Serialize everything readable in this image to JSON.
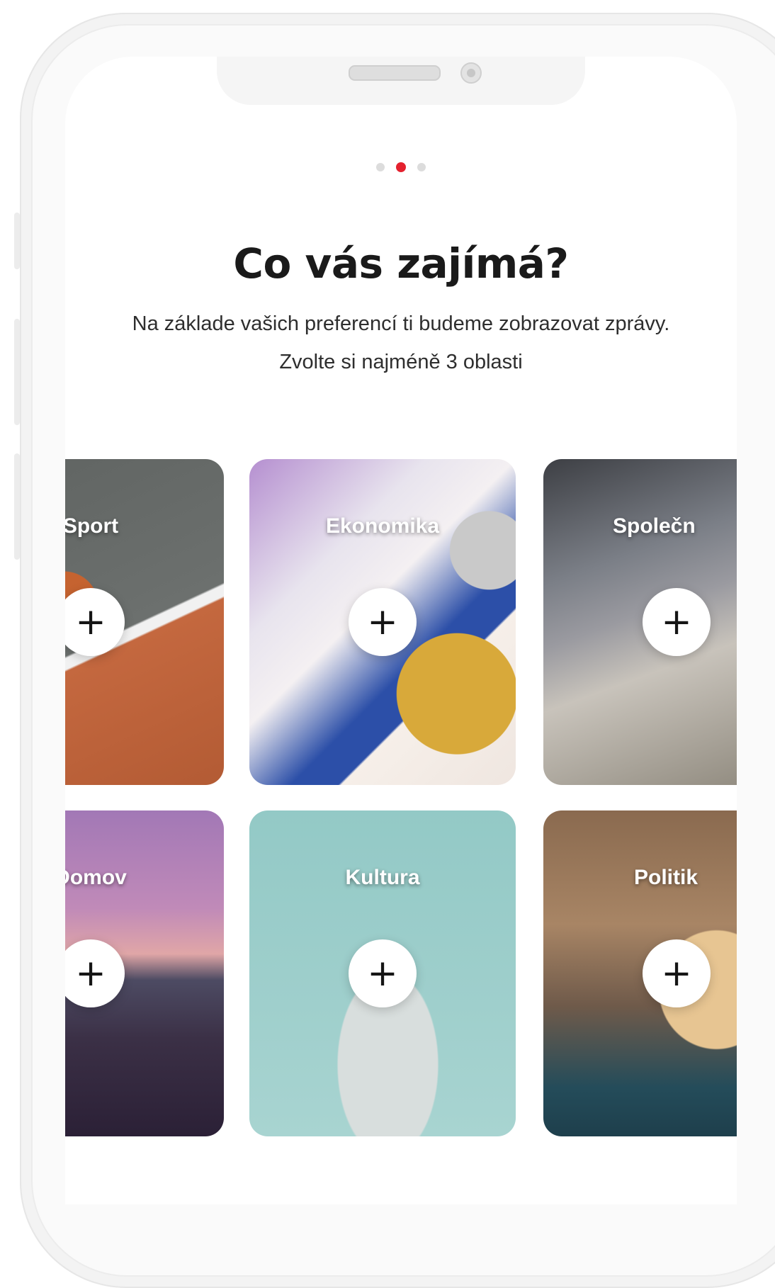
{
  "onboarding": {
    "step_dots": [
      {
        "active": false
      },
      {
        "active": true
      },
      {
        "active": false
      }
    ],
    "title": "Co vás zajímá?",
    "subtitle": "Na základe vašich preferencí ti budeme zobrazovat zprávy. Zvolte si najméně 3 oblasti"
  },
  "categories": [
    {
      "label": "Sport",
      "action": "+"
    },
    {
      "label": "Ekonomika",
      "action": "+"
    },
    {
      "label": "Společn",
      "action": "+"
    },
    {
      "label": "Domov",
      "action": "+"
    },
    {
      "label": "Kultura",
      "action": "+"
    },
    {
      "label": "Politik",
      "action": "+"
    }
  ],
  "colors": {
    "accent": "#e4212e",
    "text": "#1a1a1a",
    "inactive_dot": "#dcdcdc"
  }
}
